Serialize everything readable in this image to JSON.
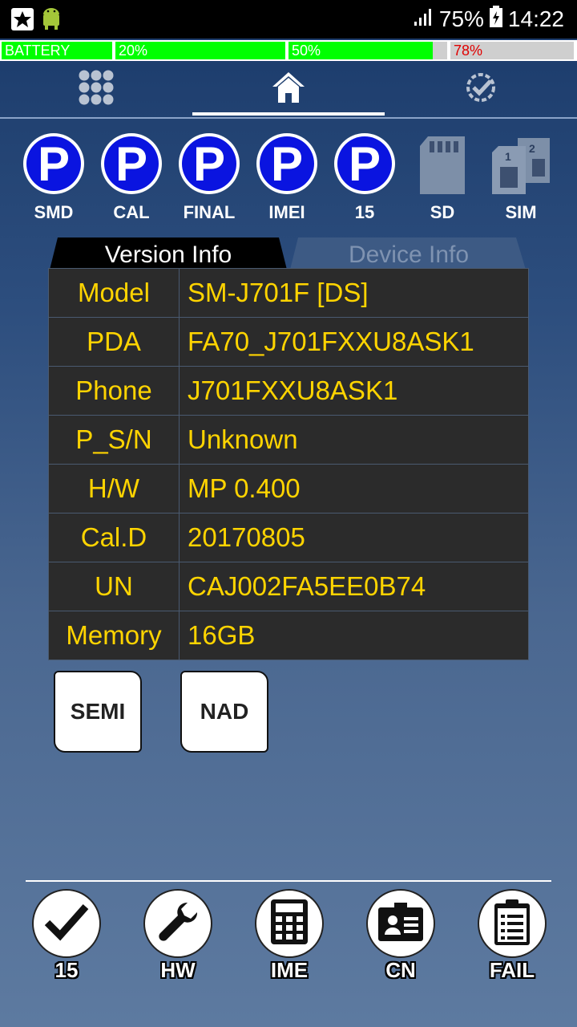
{
  "status_bar": {
    "signal": "75%",
    "time": "14:22",
    "icons": [
      "star-icon",
      "android-icon",
      "signal-icon",
      "battery-charging-icon"
    ]
  },
  "battery_bar": {
    "label": "BATTERY",
    "segments": [
      {
        "label": "20%",
        "color": "#00ff00"
      },
      {
        "label": "50%",
        "color": "#00ff00"
      },
      {
        "label": "78%",
        "color": "#e00000"
      }
    ]
  },
  "nav": {
    "items": [
      "grid-icon",
      "home-icon",
      "check-gear-icon"
    ],
    "active": "home-icon"
  },
  "status_items": [
    {
      "letter": "P",
      "label": "SMD"
    },
    {
      "letter": "P",
      "label": "CAL"
    },
    {
      "letter": "P",
      "label": "FINAL"
    },
    {
      "letter": "P",
      "label": "IMEI"
    },
    {
      "letter": "P",
      "label": "15"
    }
  ],
  "storage_items": [
    {
      "label": "SD",
      "icon": "sd-card-icon"
    },
    {
      "label": "SIM",
      "icon": "sim-card-icon"
    }
  ],
  "tabs": {
    "version": "Version Info",
    "device": "Device Info"
  },
  "info_rows": [
    {
      "key": "Model",
      "value": "SM-J701F [DS]"
    },
    {
      "key": "PDA",
      "value": "FA70_J701FXXU8ASK1"
    },
    {
      "key": "Phone",
      "value": "J701FXXU8ASK1"
    },
    {
      "key": "P_S/N",
      "value": "Unknown"
    },
    {
      "key": "H/W",
      "value": "MP 0.400"
    },
    {
      "key": "Cal.D",
      "value": "20170805"
    },
    {
      "key": "UN",
      "value": "CAJ002FA5EE0B74"
    },
    {
      "key": "Memory",
      "value": "16GB"
    }
  ],
  "buttons": {
    "semi": "SEMI",
    "nad": "NAD"
  },
  "bottom": [
    {
      "label": "15",
      "icon": "checkmark-icon"
    },
    {
      "label": "HW",
      "icon": "wrench-icon"
    },
    {
      "label": "IME",
      "icon": "calculator-icon"
    },
    {
      "label": "CN",
      "icon": "id-card-icon"
    },
    {
      "label": "FAIL",
      "icon": "clipboard-list-icon"
    }
  ]
}
